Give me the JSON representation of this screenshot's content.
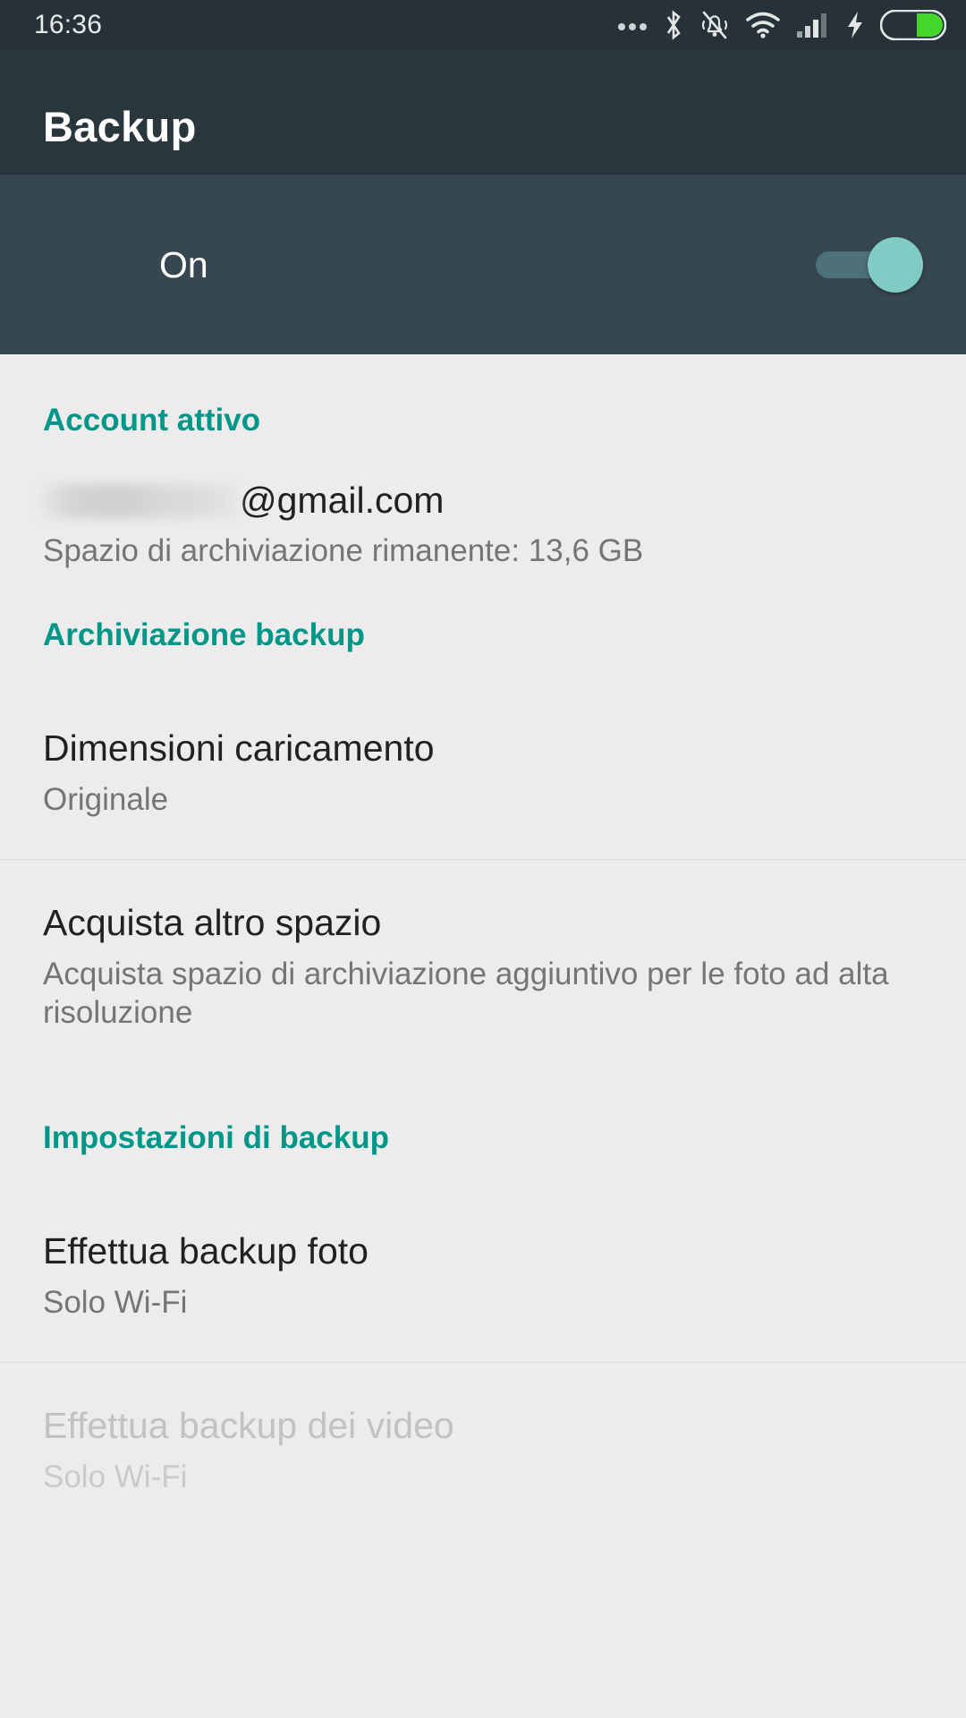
{
  "status_bar": {
    "time": "16:36",
    "icons": [
      "more-dots-icon",
      "bluetooth-icon",
      "vibrate-off-icon",
      "wifi-icon",
      "cellular-signal-icon",
      "charging-bolt-icon",
      "battery-icon"
    ],
    "battery_fill_color": "#44d62c",
    "background_color": "#263238"
  },
  "app_bar": {
    "title": "Backup",
    "background_color": "#29373d"
  },
  "master_toggle": {
    "label": "On",
    "state": "on",
    "track_color": "#4d7079",
    "thumb_color": "#80cbc4",
    "row_background": "#37474f"
  },
  "accent_color": "#009688",
  "sections": [
    {
      "header": "Account attivo",
      "account": {
        "username_redacted": true,
        "email_domain": "@gmail.com",
        "storage_line": "Spazio di archiviazione rimanente: 13,6 GB"
      }
    },
    {
      "header": "Archiviazione backup",
      "items": [
        {
          "title": "Dimensioni caricamento",
          "subtitle": "Originale",
          "disabled": false
        },
        {
          "title": "Acquista altro spazio",
          "subtitle": "Acquista spazio di archiviazione aggiuntivo per le foto ad alta risoluzione",
          "disabled": false
        }
      ]
    },
    {
      "header": "Impostazioni di backup",
      "items": [
        {
          "title": "Effettua backup foto",
          "subtitle": "Solo Wi-Fi",
          "disabled": false
        },
        {
          "title": "Effettua backup dei video",
          "subtitle": "Solo Wi-Fi",
          "disabled": true
        }
      ]
    }
  ]
}
